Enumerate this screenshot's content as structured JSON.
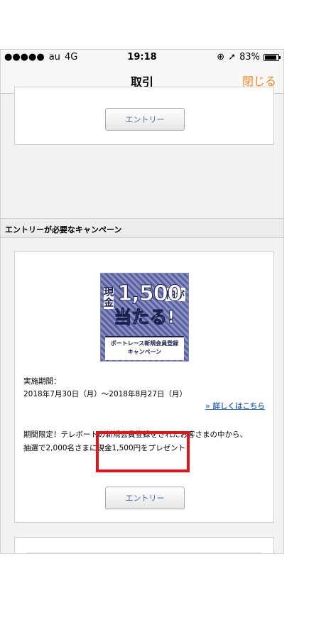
{
  "status_bar": {
    "carrier": "au",
    "network": "4G",
    "time": "19:18",
    "battery_percent": "83%"
  },
  "nav": {
    "title": "取引",
    "close_label": "閉じる"
  },
  "top_card": {
    "entry_button": "エントリー"
  },
  "section": {
    "title": "エントリーが必要なキャンペーン"
  },
  "campaign": {
    "banner": {
      "line1": "現金",
      "amount": "1,500",
      "yen": "円が",
      "line2": "当たる!",
      "caption_line1": "ボートレース新規会員登録",
      "caption_line2": "キャンペーン"
    },
    "period_label": "実施期間：",
    "period_value": "2018年7月30日（月）〜2018年8月27日（月）",
    "detail_link": "» 詳しくはこちら",
    "description_line1": "期間限定！テレボートの新規会員登録をされたお客さまの中から、",
    "description_line2": "抽選で2,000名さまに現金1,500円をプレゼント！",
    "entry_button": "エントリー"
  },
  "colors": {
    "accent": "#f08a24",
    "link": "#3c6fb0",
    "highlight": "#e2141a"
  }
}
